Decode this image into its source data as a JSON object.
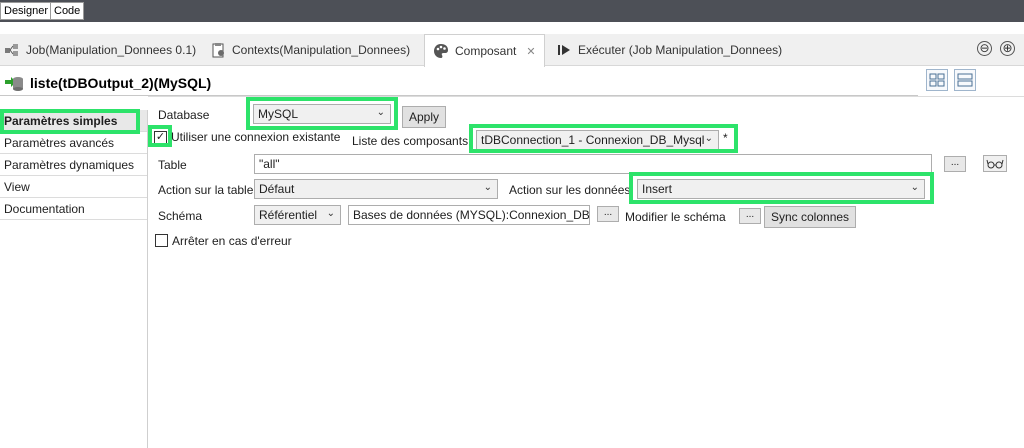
{
  "top_tabs": [
    "Designer",
    "Code"
  ],
  "view_tabs": [
    {
      "label": "Job(Manipulation_Donnees 0.1)"
    },
    {
      "label": "Contexts(Manipulation_Donnees)"
    },
    {
      "label": "Composant"
    },
    {
      "label": "Exécuter (Job Manipulation_Donnees)"
    }
  ],
  "view_controls": {
    "minimize": "⊖",
    "maximize": "⊕"
  },
  "component": {
    "title": "liste(tDBOutput_2)(MySQL)"
  },
  "sidebar": {
    "items": [
      {
        "label": "Paramètres simples"
      },
      {
        "label": "Paramètres avancés"
      },
      {
        "label": "Paramètres dynamiques"
      },
      {
        "label": "View"
      },
      {
        "label": "Documentation"
      }
    ]
  },
  "form": {
    "database_label": "Database",
    "database_value": "MySQL",
    "apply_label": "Apply",
    "use_existing_label": "Utiliser une connexion existante",
    "use_existing_checked": "✓",
    "component_list_label": "Liste des composants",
    "component_list_value": "tDBConnection_1 - Connexion_DB_Mysql",
    "component_list_marker": "*",
    "table_label": "Table",
    "table_value": "\"all\"",
    "table_action_label": "Action sur la table",
    "table_action_value": "Défaut",
    "data_action_label": "Action sur les données",
    "data_action_value": "Insert",
    "schema_label": "Schéma",
    "schema_type_value": "Référentiel",
    "schema_repo_value": "Bases de données (MYSQL):Connexion_DB_M",
    "modify_schema_label": "Modifier le schéma",
    "sync_columns_label": "Sync colonnes",
    "stop_on_error_label": "Arrêter en cas d'erreur",
    "browse_label": "..."
  },
  "colors": {
    "highlight": "#2de36a",
    "top_strip": "#4d5057"
  }
}
